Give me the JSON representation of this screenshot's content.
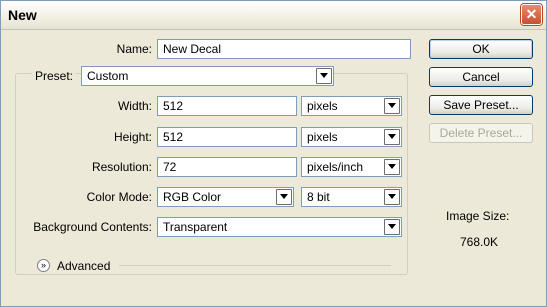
{
  "window": {
    "title": "New"
  },
  "form": {
    "name_label": "Name:",
    "name_value": "New Decal",
    "preset_label": "Preset:",
    "preset_value": "Custom",
    "width_label": "Width:",
    "width_value": "512",
    "width_unit": "pixels",
    "height_label": "Height:",
    "height_value": "512",
    "height_unit": "pixels",
    "resolution_label": "Resolution:",
    "resolution_value": "72",
    "resolution_unit": "pixels/inch",
    "color_mode_label": "Color Mode:",
    "color_mode_value": "RGB Color",
    "bit_depth_value": "8 bit",
    "background_label": "Background Contents:",
    "background_value": "Transparent",
    "advanced_label": "Advanced"
  },
  "buttons": {
    "ok": "OK",
    "cancel": "Cancel",
    "save_preset": "Save Preset...",
    "delete_preset": "Delete Preset..."
  },
  "info": {
    "image_size_label": "Image Size:",
    "image_size_value": "768.0K"
  },
  "icons": {
    "close": "close-icon",
    "dropdown": "chevron-down-icon",
    "expand": "double-chevron-down-icon"
  }
}
